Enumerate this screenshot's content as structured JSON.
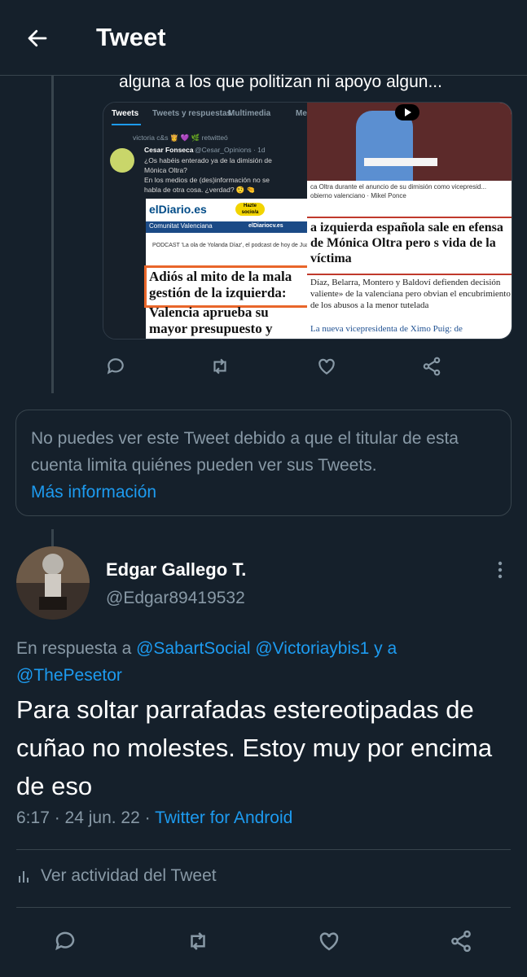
{
  "header": {
    "title": "Tweet",
    "back_icon": "arrow-left-icon"
  },
  "quoted_tweet": {
    "snippet": "alguna a los que politizan ni apoyo algun...",
    "media": {
      "left": {
        "tabs": [
          "Tweets",
          "Tweets y respuestas",
          "Multimedia",
          "Me"
        ],
        "retweet_line": "victoria c&s 👸 💜 🌿 retwitteó",
        "author": "Cesar Fonseca",
        "author_handle": "@Cesar_Opinions · 1d",
        "lines": [
          "¿Os habéis enterado ya de la dimisión de",
          "Mónica Oltra?",
          "En los medios de (des)información no se",
          "habla de otra cosa. ¿verdad? 🤨 🤏"
        ],
        "paper_logo": "elDiario.es",
        "paper_pill": "Hazte socio/a",
        "paper_section": "Comunitat Valenciana",
        "paper_section_right": "elDiariocv.es",
        "podcast": "PODCAST 'La ola de Yolanda Díaz', el podcast de hoy de Juanlu Sánchez",
        "headline_lines": [
          "Adiós al mito de la mala",
          "gestión de la izquierda:",
          "Valencia aprueba su",
          "mayor presupuesto y"
        ]
      },
      "right": {
        "caption": "ca Oltra durante el anuncio de su dimisión como vicepresid... obierno valenciano · Mikel Ponce",
        "headline": "a izquierda española sale en efensa de Mónica Oltra pero s vida de la víctima",
        "sub": "Díaz, Belarra, Montero y Baldoví defienden decisión valiente» de la valenciana pero obvian el encubrimiento de los abusos a la menor tutelada",
        "link": "La nueva vicepresidenta de Ximo Puig: de"
      }
    }
  },
  "notice": {
    "text": "No puedes ver este Tweet debido a que el titular de esta cuenta limita quiénes pueden ver sus Tweets.",
    "link": "Más información"
  },
  "tweet": {
    "display_name": "Edgar Gallego T.",
    "handle": "@Edgar89419532",
    "reply_prefix": "En respuesta a",
    "reply_mentions": "@SabartSocial @Victoriaybis1 y a",
    "reply_mentions_2": "@ThePesetor",
    "text": "Para soltar parrafadas estereotipadas de cuñao no molestes. Estoy muy por encima de eso",
    "time": "6:17 · 24 jun. 22 ·",
    "source": "Twitter for Android",
    "activity": "Ver actividad del Tweet"
  },
  "icons": {
    "reply": "reply-icon",
    "retweet": "retweet-icon",
    "like": "heart-icon",
    "share": "share-icon",
    "more": "more-vertical-icon",
    "activity": "bar-chart-icon"
  },
  "colors": {
    "background": "#15202b",
    "accent": "#1d9bf0",
    "muted": "#8899a6",
    "border": "#38444d"
  }
}
